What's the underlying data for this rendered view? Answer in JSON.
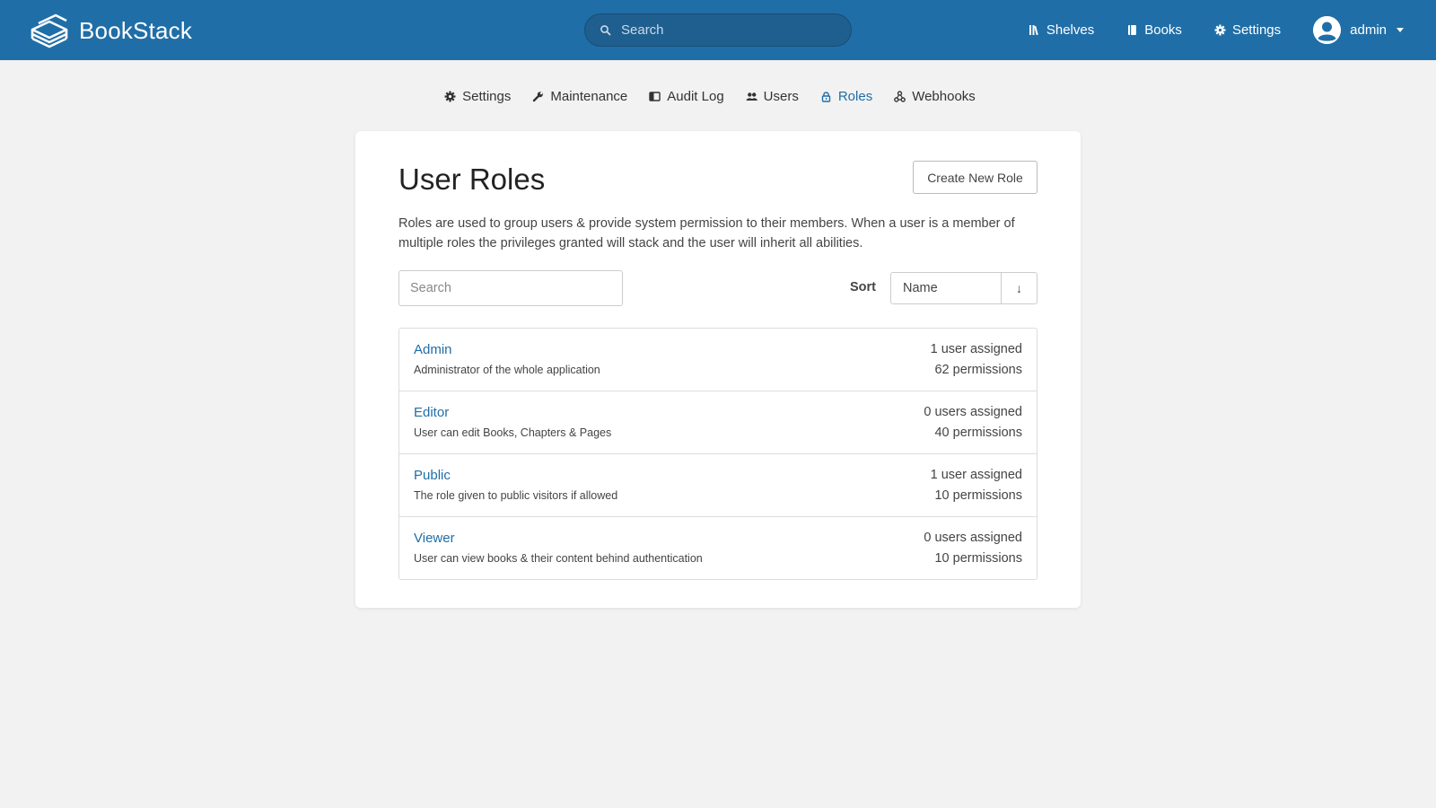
{
  "header": {
    "brand": "BookStack",
    "search_placeholder": "Search",
    "nav": [
      {
        "label": "Shelves",
        "icon": "shelves-icon"
      },
      {
        "label": "Books",
        "icon": "books-icon"
      },
      {
        "label": "Settings",
        "icon": "gear-icon"
      }
    ],
    "user": "admin",
    "brand_color": "#206ea7"
  },
  "subnav": [
    {
      "label": "Settings",
      "icon": "gear-icon",
      "active": false
    },
    {
      "label": "Maintenance",
      "icon": "wrench-icon",
      "active": false
    },
    {
      "label": "Audit Log",
      "icon": "audit-log-icon",
      "active": false
    },
    {
      "label": "Users",
      "icon": "users-icon",
      "active": false
    },
    {
      "label": "Roles",
      "icon": "lock-icon",
      "active": true
    },
    {
      "label": "Webhooks",
      "icon": "webhooks-icon",
      "active": false
    }
  ],
  "main": {
    "title": "User Roles",
    "create_button": "Create New Role",
    "description": "Roles are used to group users & provide system permission to their members. When a user is a member of multiple roles the privileges granted will stack and the user will inherit all abilities.",
    "search_placeholder": "Search",
    "sort_label": "Sort",
    "sort_value": "Name",
    "sort_direction": "↓",
    "roles": [
      {
        "name": "Admin",
        "description": "Administrator of the whole application",
        "users": "1 user assigned",
        "permissions": "62 permissions"
      },
      {
        "name": "Editor",
        "description": "User can edit Books, Chapters & Pages",
        "users": "0 users assigned",
        "permissions": "40 permissions"
      },
      {
        "name": "Public",
        "description": "The role given to public visitors if allowed",
        "users": "1 user assigned",
        "permissions": "10 permissions"
      },
      {
        "name": "Viewer",
        "description": "User can view books & their content behind authentication",
        "users": "0 users assigned",
        "permissions": "10 permissions"
      }
    ]
  }
}
